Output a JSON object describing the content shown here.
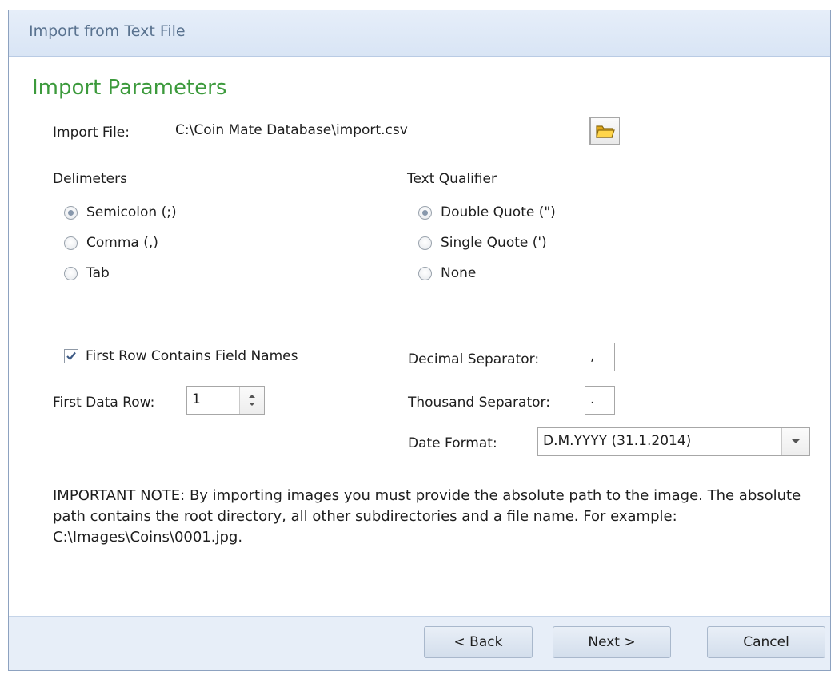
{
  "window": {
    "title": "Import from Text File"
  },
  "section": {
    "title": "Import Parameters"
  },
  "import_file": {
    "label": "Import File:",
    "value": "C:\\Coin Mate Database\\import.csv"
  },
  "delimiters": {
    "heading": "Delimeters",
    "options": [
      {
        "label": "Semicolon (;)",
        "checked": true
      },
      {
        "label": "Comma (,)",
        "checked": false
      },
      {
        "label": "Tab",
        "checked": false
      }
    ]
  },
  "text_qualifier": {
    "heading": "Text Qualifier",
    "options": [
      {
        "label": "Double Quote (\")",
        "checked": true
      },
      {
        "label": "Single Quote (')",
        "checked": false
      },
      {
        "label": "None",
        "checked": false
      }
    ]
  },
  "first_row": {
    "label": "First Row Contains Field Names",
    "checked": true
  },
  "first_data_row": {
    "label": "First Data Row:",
    "value": "1"
  },
  "decimal_separator": {
    "label": "Decimal Separator:",
    "value": ","
  },
  "thousand_separator": {
    "label": "Thousand Separator:",
    "value": "."
  },
  "date_format": {
    "label": "Date Format:",
    "value": "D.M.YYYY (31.1.2014)"
  },
  "note": {
    "text": "IMPORTANT NOTE:  By importing images you must provide the absolute path to the image. The absolute path contains the root directory, all other subdirectories and a file name. For example: C:\\Images\\Coins\\0001.jpg."
  },
  "buttons": {
    "back": "< Back",
    "next": "Next >",
    "cancel": "Cancel"
  },
  "icons": {
    "browse": "folder-open-icon",
    "spin": "spinner-arrows-icon",
    "dropdown": "chevron-down-icon",
    "check": "checkmark-icon"
  }
}
